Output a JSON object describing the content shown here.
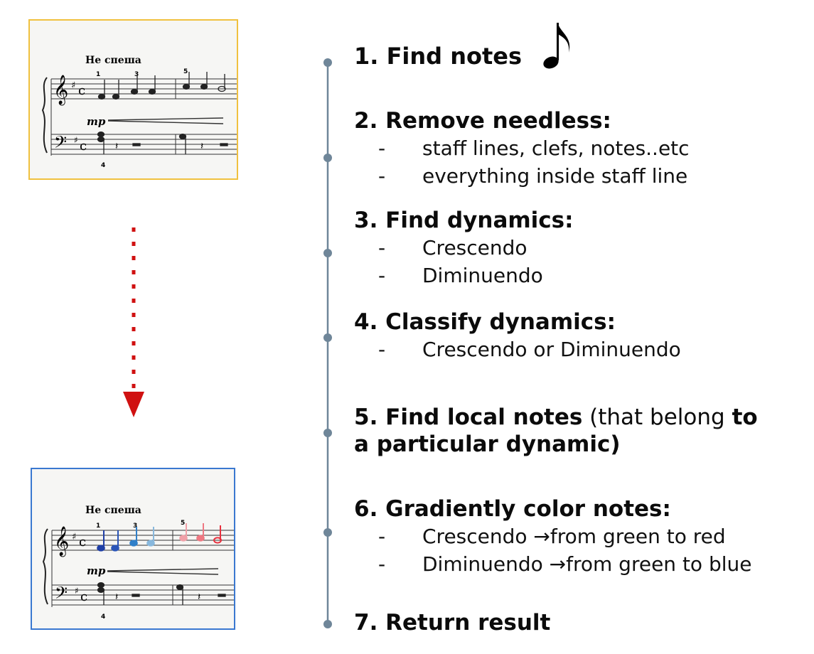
{
  "scores": {
    "tempo_marking": "Не спеша",
    "dynamic_marking": "mp",
    "fingering_top": [
      "1",
      "3",
      "5"
    ],
    "fingering_bottom": "4",
    "colors": {
      "top_border": "#f0c13f",
      "bottom_border": "#3a78d0",
      "dark_blue": "#1f3fa6",
      "mid_blue": "#2f7fc8",
      "light_blue": "#88b8dd",
      "light_red": "#f0a0a8",
      "red": "#e8303e"
    }
  },
  "arrow": {
    "color": "#d01111"
  },
  "timeline": {
    "color": "#6f8699"
  },
  "steps": [
    {
      "title": "1. Find notes",
      "icon": "eighth-note-icon",
      "bullets": []
    },
    {
      "title": "2. Remove needless:",
      "bullets": [
        "staff lines, clefs, notes..etc",
        "everything inside staff line"
      ]
    },
    {
      "title": "3. Find dynamics:",
      "bullets": [
        "Crescendo",
        "Diminuendo"
      ]
    },
    {
      "title": "4. Classify dynamics:",
      "bullets": [
        "Crescendo or Diminuendo"
      ]
    },
    {
      "title_part1": "5. Find local notes",
      "title_part2": " (that belong ",
      "title_part3": "to",
      "title_line2": "a particular dynamic)",
      "bullets": []
    },
    {
      "title": "6. Gradiently color notes:",
      "bullets": [
        "Crescendo →from green to red",
        "Diminuendo →from green to blue"
      ]
    },
    {
      "title": "7. Return result",
      "bullets": []
    }
  ],
  "bullet_dash": "-"
}
